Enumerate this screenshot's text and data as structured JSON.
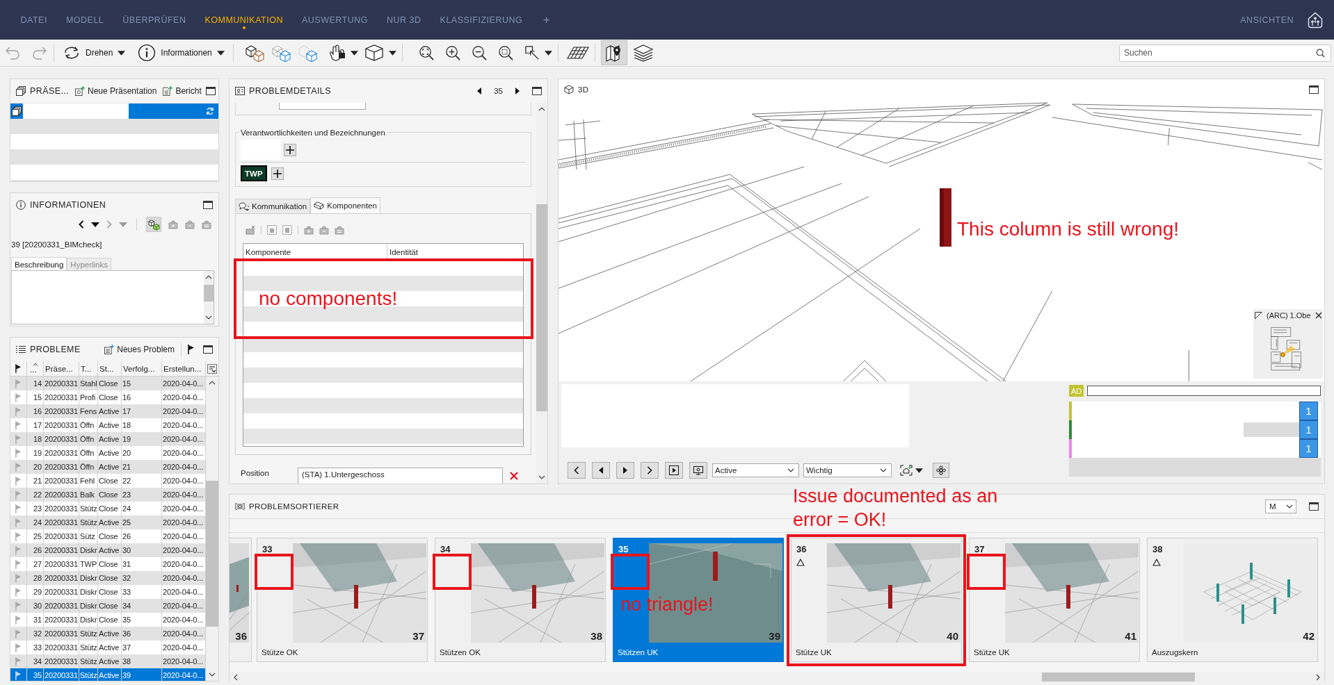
{
  "menu": {
    "items": [
      {
        "label": "DATEI",
        "selected": false
      },
      {
        "label": "MODELL",
        "selected": false
      },
      {
        "label": "ÜBERPRÜFEN",
        "selected": false
      },
      {
        "label": "KOMMUNIKATION",
        "selected": true
      },
      {
        "label": "AUSWERTUNG",
        "selected": false
      },
      {
        "label": "NUR 3D",
        "selected": false
      },
      {
        "label": "KLASSIFIZIERUNG",
        "selected": false
      }
    ],
    "add": "+",
    "views": "ANSICHTEN"
  },
  "toolbar": {
    "undo_disabled": true,
    "redo_disabled": true,
    "rotate": "Drehen",
    "info": "Informationen",
    "map_selected": true,
    "search": {
      "placeholder": "Suchen"
    }
  },
  "presentations": {
    "title": "PRÄSE...",
    "new": "Neue Präsentation",
    "report": "Bericht",
    "rows": [
      {
        "selected": true,
        "editing": true
      }
    ]
  },
  "information": {
    "title": "INFORMATIONEN",
    "forward_disabled": true,
    "record": "39 [20200331_BIMcheck]",
    "tabs": [
      {
        "label": "Beschreibung",
        "selected": true
      },
      {
        "label": "Hyperlinks",
        "selected": false
      }
    ]
  },
  "problems": {
    "title": "PROBLEME",
    "new": "Neues Problem",
    "columns": [
      "...",
      "Präse...",
      "T...",
      "St...",
      "Verfolg...",
      "Erstellun..."
    ],
    "rows": [
      {
        "number": "14",
        "presentation": "20200331",
        "title": "Stahl",
        "status": "Close",
        "tracking": "15",
        "created": "2020-04-0...",
        "flagged": false,
        "selected": false
      },
      {
        "number": "15",
        "presentation": "20200331",
        "title": "Profi",
        "status": "Close",
        "tracking": "16",
        "created": "2020-04-0...",
        "flagged": false,
        "selected": false
      },
      {
        "number": "16",
        "presentation": "20200331",
        "title": "Fens",
        "status": "Active",
        "tracking": "17",
        "created": "2020-04-0...",
        "flagged": false,
        "selected": false
      },
      {
        "number": "17",
        "presentation": "20200331",
        "title": "Öffn",
        "status": "Active",
        "tracking": "18",
        "created": "2020-04-0...",
        "flagged": false,
        "selected": false
      },
      {
        "number": "18",
        "presentation": "20200331",
        "title": "Öffn",
        "status": "Active",
        "tracking": "19",
        "created": "2020-04-0...",
        "flagged": false,
        "selected": false
      },
      {
        "number": "19",
        "presentation": "20200331",
        "title": "Öffn",
        "status": "Active",
        "tracking": "20",
        "created": "2020-04-0...",
        "flagged": false,
        "selected": false
      },
      {
        "number": "20",
        "presentation": "20200331",
        "title": "Öffn",
        "status": "Active",
        "tracking": "21",
        "created": "2020-04-0...",
        "flagged": false,
        "selected": false
      },
      {
        "number": "21",
        "presentation": "20200331",
        "title": "Fehl",
        "status": "Close",
        "tracking": "22",
        "created": "2020-04-0...",
        "flagged": false,
        "selected": false
      },
      {
        "number": "22",
        "presentation": "20200331",
        "title": "Balk",
        "status": "Close",
        "tracking": "23",
        "created": "2020-04-0...",
        "flagged": false,
        "selected": false
      },
      {
        "number": "23",
        "presentation": "20200331",
        "title": "Stütz",
        "status": "Close",
        "tracking": "24",
        "created": "2020-04-0...",
        "flagged": false,
        "selected": false
      },
      {
        "number": "24",
        "presentation": "20200331",
        "title": "Stütz",
        "status": "Active",
        "tracking": "25",
        "created": "2020-04-0...",
        "flagged": false,
        "selected": false
      },
      {
        "number": "25",
        "presentation": "20200331",
        "title": "Sütz",
        "status": "Close",
        "tracking": "26",
        "created": "2020-04-0...",
        "flagged": false,
        "selected": false
      },
      {
        "number": "26",
        "presentation": "20200331",
        "title": "Diskr",
        "status": "Active",
        "tracking": "30",
        "created": "2020-04-0...",
        "flagged": false,
        "selected": false
      },
      {
        "number": "27",
        "presentation": "20200331",
        "title": "TWP",
        "status": "Close",
        "tracking": "31",
        "created": "2020-04-0...",
        "flagged": false,
        "selected": false
      },
      {
        "number": "28",
        "presentation": "20200331",
        "title": "Diskr",
        "status": "Close",
        "tracking": "32",
        "created": "2020-04-0...",
        "flagged": false,
        "selected": false
      },
      {
        "number": "29",
        "presentation": "20200331",
        "title": "Diskr",
        "status": "Close",
        "tracking": "33",
        "created": "2020-04-0...",
        "flagged": false,
        "selected": false
      },
      {
        "number": "30",
        "presentation": "20200331",
        "title": "Diskr",
        "status": "Close",
        "tracking": "34",
        "created": "2020-04-0...",
        "flagged": false,
        "selected": false
      },
      {
        "number": "31",
        "presentation": "20200331",
        "title": "Diskr",
        "status": "Close",
        "tracking": "35",
        "created": "2020-04-0...",
        "flagged": false,
        "selected": false
      },
      {
        "number": "32",
        "presentation": "20200331",
        "title": "Stütz",
        "status": "Active",
        "tracking": "36",
        "created": "2020-04-0...",
        "flagged": false,
        "selected": false
      },
      {
        "number": "33",
        "presentation": "20200331",
        "title": "Stütz",
        "status": "Active",
        "tracking": "37",
        "created": "2020-04-0...",
        "flagged": false,
        "selected": false
      },
      {
        "number": "34",
        "presentation": "20200331",
        "title": "Stütz",
        "status": "Active",
        "tracking": "38",
        "created": "2020-04-0...",
        "flagged": false,
        "selected": false
      },
      {
        "number": "35",
        "presentation": "20200331",
        "title": "Stütz",
        "status": "Active",
        "tracking": "39",
        "created": "2020-04-0...",
        "flagged": false,
        "selected": true
      }
    ]
  },
  "details": {
    "title": "PROBLEMDETAILS",
    "current": "35",
    "group": "Verantwortlichkeiten und Bezeichnungen",
    "tag": "TWP",
    "tabs": [
      {
        "label": "Kommunikation",
        "selected": false
      },
      {
        "label": "Komponenten",
        "selected": true
      }
    ],
    "columns": [
      "Komponente",
      "Identität"
    ],
    "annotation": "no components!",
    "position_label": "Position",
    "position": "(STA) 1.Untergeschoss"
  },
  "view3d": {
    "title": "3D",
    "annotation": "This column is still wrong!",
    "minimap_label": "(ARC) 1.Obe",
    "status": "Active",
    "priority": "Wichtig",
    "author": "AD",
    "markups": [
      {
        "color": "#c3c332",
        "count": "1",
        "selected": false
      },
      {
        "color": "#2e8b3a",
        "count": "1",
        "selected": true
      },
      {
        "color": "#ee82ee",
        "count": "1",
        "selected": false
      }
    ]
  },
  "sorter": {
    "title": "PROBLEMSORTIERER",
    "size": "M",
    "cards": [
      {
        "kind": "clipped",
        "badge": "36",
        "selected": false
      },
      {
        "kind": "full",
        "number": "33",
        "badge": "37",
        "title": "Stütze OK",
        "warning": false,
        "selected": false,
        "marked": true,
        "highlighted": false
      },
      {
        "kind": "full",
        "number": "34",
        "badge": "38",
        "title": "Stützen OK",
        "warning": false,
        "selected": false,
        "marked": true,
        "highlighted": false
      },
      {
        "kind": "full",
        "number": "35",
        "badge": "39",
        "title": "Stützen UK",
        "warning": false,
        "selected": true,
        "marked": true,
        "highlighted": false,
        "note": {
          "kind": "inline",
          "text": "no triangle!"
        }
      },
      {
        "kind": "full",
        "number": "36",
        "badge": "40",
        "title": "Stütze UK",
        "warning": true,
        "selected": false,
        "marked": false,
        "highlighted": true,
        "note": {
          "kind": "callout",
          "text": "Issue documented as an error = OK!"
        }
      },
      {
        "kind": "full",
        "number": "37",
        "badge": "41",
        "title": "Stütze UK",
        "warning": false,
        "selected": false,
        "marked": true,
        "highlighted": false
      },
      {
        "kind": "full",
        "number": "38",
        "badge": "42",
        "title": "Auszugskern",
        "warning": true,
        "selected": false,
        "marked": false,
        "highlighted": false
      }
    ]
  }
}
